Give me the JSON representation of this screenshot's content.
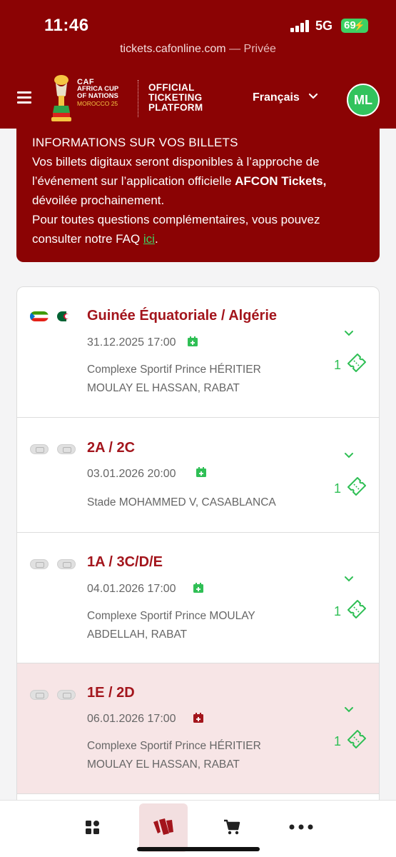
{
  "status": {
    "time": "11:46",
    "network": "5G",
    "battery": "69"
  },
  "browser": {
    "url": "tickets.cafonline.com",
    "mode": "— Privée"
  },
  "header": {
    "logo": {
      "caf": "CAF",
      "line1": "AFRICA CUP",
      "line2": "OF NATIONS",
      "line3": "MOROCCO 25"
    },
    "platform": [
      "OFFICIAL",
      "TICKETING",
      "PLATFORM"
    ],
    "language": "Français",
    "avatar": "ML"
  },
  "info": {
    "title": "INFORMATIONS SUR VOS BILLETS",
    "line1": "Vos billets digitaux seront disponibles à l’approche de",
    "line2_a": "l’événement sur l’application officielle ",
    "line2_b": "AFCON Tickets,",
    "line3": "dévoilée prochainement.",
    "line4": "Pour toutes questions complémentaires, vous pouvez",
    "line5_a": "consulter notre FAQ ",
    "line5_link": "ici",
    "line5_b": "."
  },
  "matches": [
    {
      "title": "Guinée Équatoriale / Algérie",
      "datetime": "31.12.2025 17:00",
      "venue_lines": [
        "Complexe Sportif Prince HÉRITIER",
        "MOULAY EL HASSAN, RABAT"
      ],
      "tickets": "1"
    },
    {
      "title": "2A / 2C",
      "datetime": "03.01.2026 20:00",
      "venue_lines": [
        "Stade MOHAMMED V, CASABLANCA"
      ],
      "tickets": "1"
    },
    {
      "title": "1A / 3C/D/E",
      "datetime": "04.01.2026 17:00",
      "venue_lines": [
        "Complexe Sportif Prince MOULAY",
        "ABDELLAH, RABAT"
      ],
      "tickets": "1"
    },
    {
      "title": "1E / 2D",
      "datetime": "06.01.2026 17:00",
      "venue_lines": [
        "Complexe Sportif Prince HÉRITIER",
        "MOULAY EL HASSAN, RABAT"
      ],
      "tickets": "1"
    }
  ],
  "colors": {
    "brand": "#8b0304",
    "accent": "#32c35d",
    "match_title": "#a3151c",
    "highlight_row": "#f7e5e6"
  },
  "bottom_nav": [
    "grid-icon",
    "tickets-icon",
    "cart-icon",
    "more-icon"
  ]
}
